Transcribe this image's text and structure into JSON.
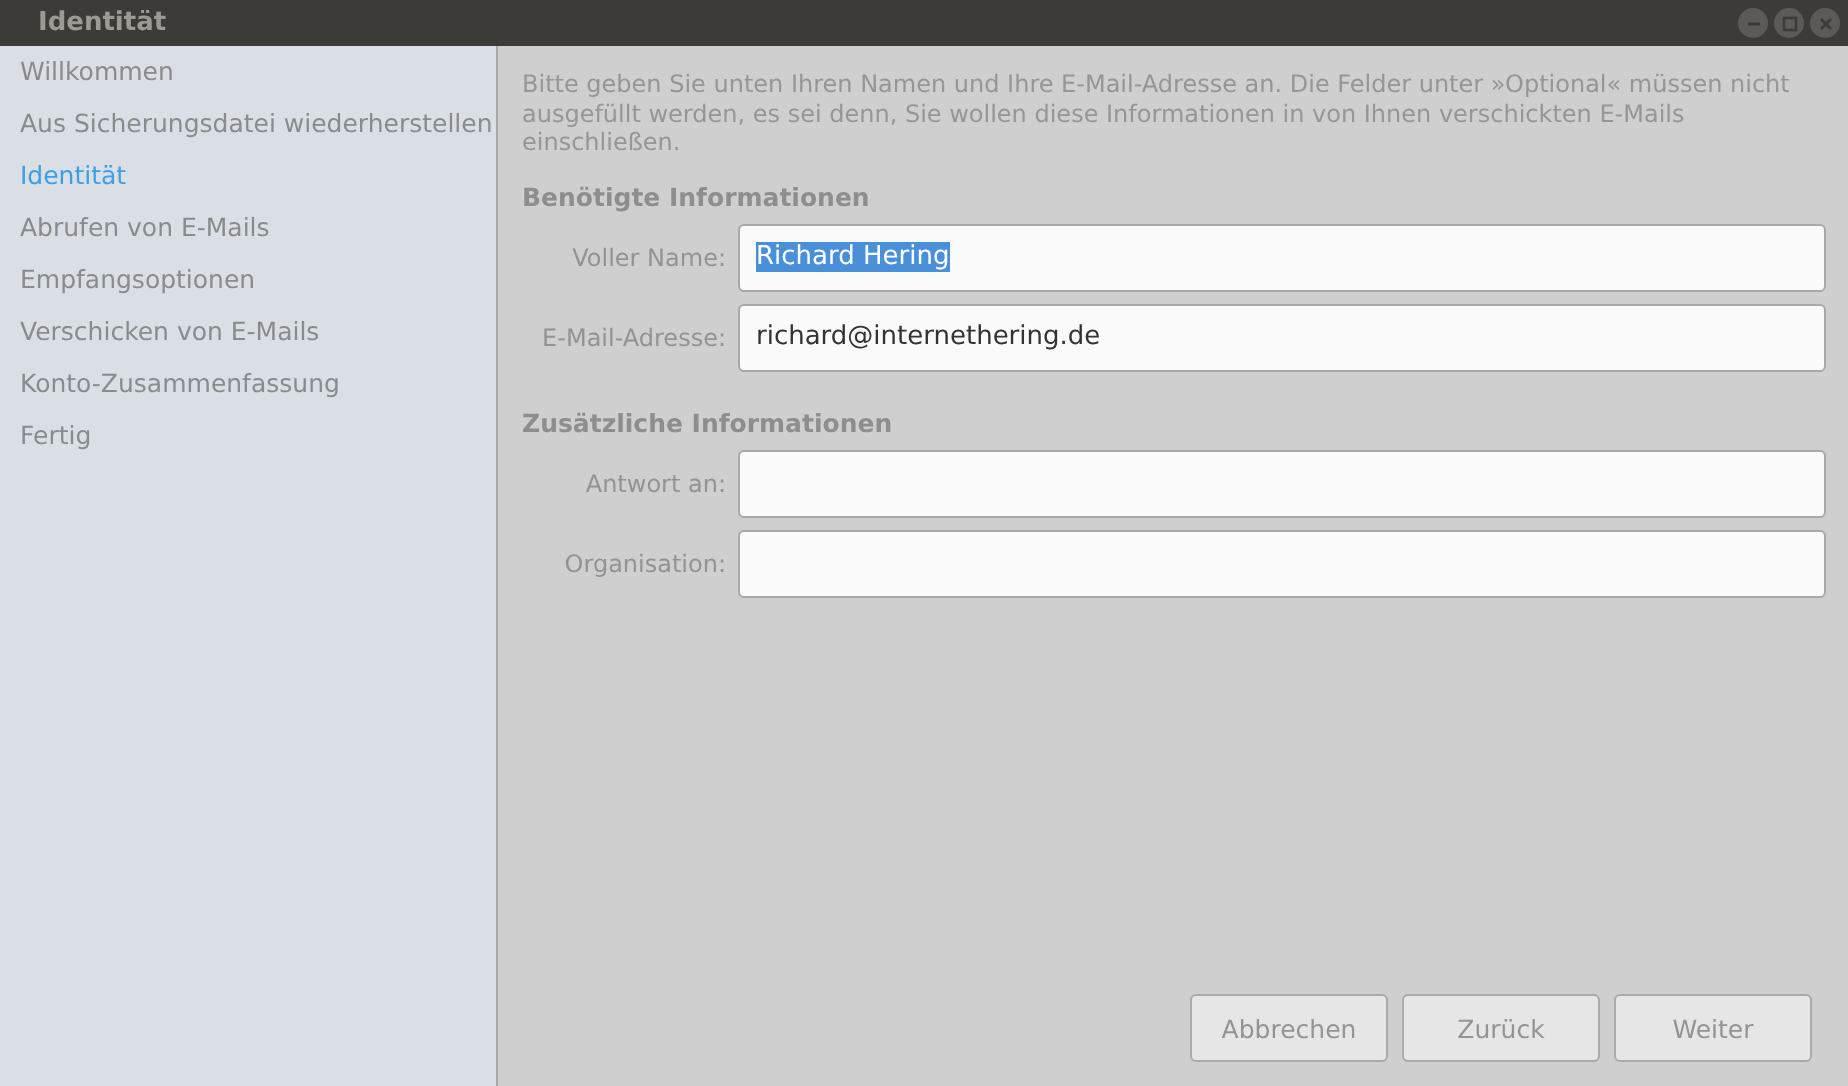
{
  "window": {
    "title": "Identität"
  },
  "sidebar": {
    "items": [
      {
        "label": "Willkommen",
        "selected": false
      },
      {
        "label": "Aus Sicherungsdatei wiederherstellen",
        "selected": false
      },
      {
        "label": "Identität",
        "selected": true
      },
      {
        "label": "Abrufen von E-Mails",
        "selected": false
      },
      {
        "label": "Empfangsoptionen",
        "selected": false
      },
      {
        "label": "Verschicken von E-Mails",
        "selected": false
      },
      {
        "label": "Konto-Zusammenfassung",
        "selected": false
      },
      {
        "label": "Fertig",
        "selected": false
      }
    ]
  },
  "intro": "Bitte geben Sie unten Ihren Namen und Ihre E-Mail-Adresse an. Die Felder unter »Optional« müssen nicht ausgefüllt werden, es sei denn, Sie wollen diese Informationen in von Ihnen verschickten E-Mails einschließen.",
  "sections": [
    {
      "heading": "Benötigte Informationen",
      "fields": [
        {
          "label": "Voller Name:",
          "value": "Richard Hering",
          "text_selected": true
        },
        {
          "label": "E-Mail-Adresse:",
          "value": "richard@internethering.de",
          "text_selected": false
        }
      ]
    },
    {
      "heading": "Zusätzliche Informationen",
      "fields": [
        {
          "label": "Antwort an:"
        },
        {
          "label": "Organisation:"
        }
      ]
    }
  ],
  "buttons": [
    "Abbrechen",
    "Zurück",
    "Weiter"
  ]
}
